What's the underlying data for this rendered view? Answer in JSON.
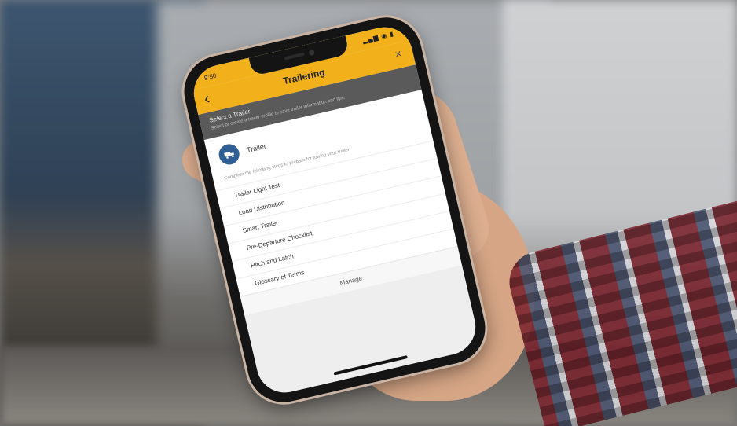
{
  "status_bar": {
    "time": "9:50",
    "signal": "▂▄▆ ◉ ▮"
  },
  "app_bar": {
    "title": "Trailering",
    "back_icon": "chevron-left-icon",
    "close_icon": "close-icon"
  },
  "banner": {
    "heading": "Select a Trailer",
    "subtext": "Select or create a trailer profile to save trailer information and tips."
  },
  "profile": {
    "name": "Trailer",
    "icon": "truck-icon"
  },
  "description": "Complete the following steps to prepare for towing your trailer.",
  "menu_items": [
    "Trailer Light Test",
    "Load Distribution",
    "Smart Trailer",
    "Pre-Departure Checklist",
    "Hitch and Latch",
    "Glossary of Terms"
  ],
  "footer": {
    "label": "Manage"
  },
  "colors": {
    "accent": "#f2b11b",
    "banner": "#5a5a5a",
    "avatar": "#2f5f95"
  }
}
